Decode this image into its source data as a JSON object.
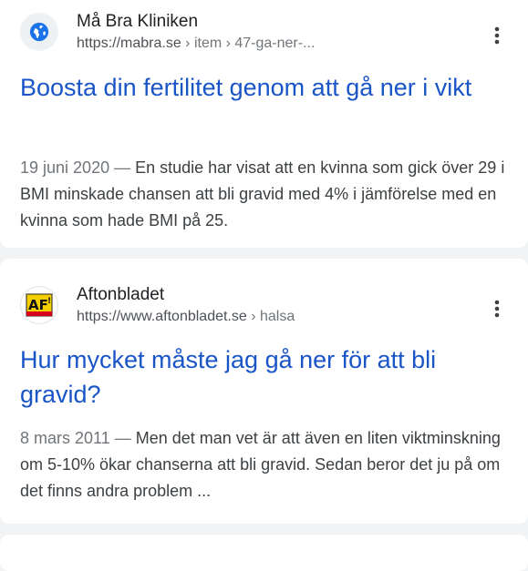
{
  "results": [
    {
      "site_name": "Må Bra Kliniken",
      "url_host": "https://mabra.se",
      "url_path": " › item › 47-ga-ner-...",
      "favicon": "globe-icon",
      "title": "Boosta din fertilitet genom att gå ner i vikt",
      "date": "19 juni 2020",
      "separator": " — ",
      "snippet": "En studie har visat att en kvinna som gick över 29 i BMI minskade chansen att bli gravid med 4% i jämförelse med en kvinna som hade BMI på 25."
    },
    {
      "site_name": "Aftonbladet",
      "url_host": "https://www.aftonbladet.se",
      "url_path": " › halsa",
      "favicon": "aftonbladet-logo-icon",
      "title": "Hur mycket måste jag gå ner för att bli gravid?",
      "date": "8 mars 2011",
      "separator": " — ",
      "snippet": "Men det man vet är att även en liten viktminskning om 5-10% ökar chanserna att bli gravid. Sedan beror det ju på om det finns andra problem ..."
    }
  ],
  "colors": {
    "link": "#1a55c8",
    "background": "#f1f3f4",
    "card": "#ffffff",
    "favicon_blue": "#1a73e8",
    "aftonbladet_yellow": "#f5d000",
    "aftonbladet_red": "#d6001c"
  },
  "icons": {
    "more": "more-vert-icon"
  }
}
